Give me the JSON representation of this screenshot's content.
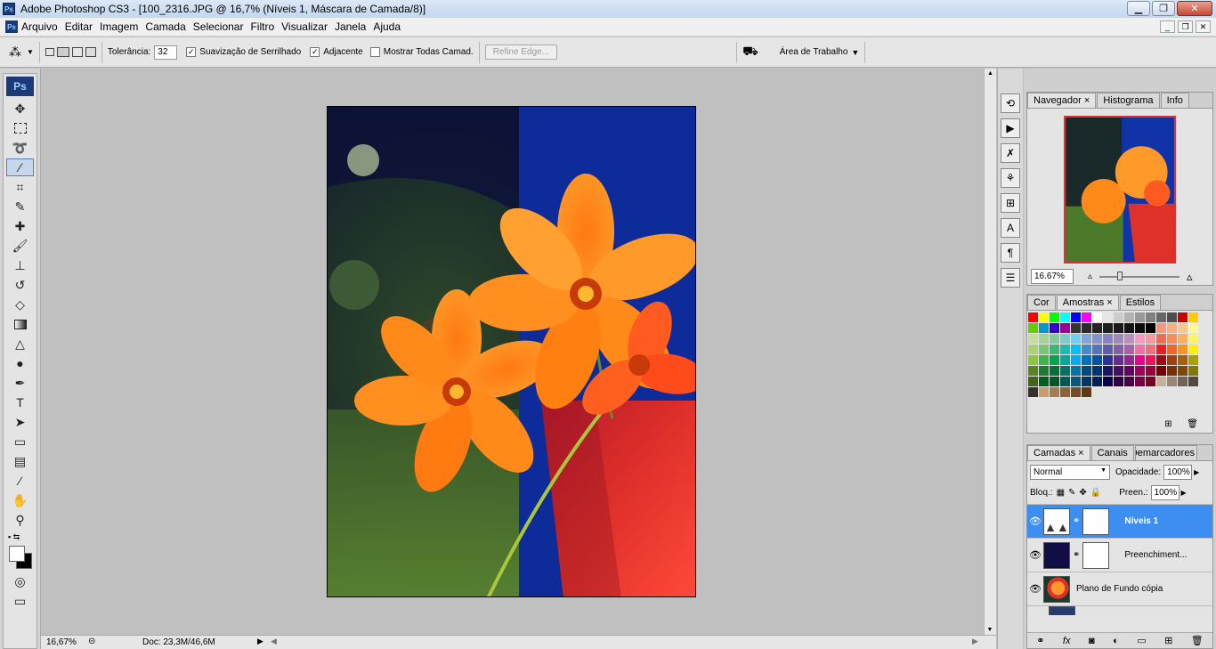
{
  "title": "Adobe Photoshop CS3 - [100_2316.JPG @ 16,7% (Níveis 1, Máscara de Camada/8)]",
  "app_icon": "Ps",
  "menu": [
    "Arquivo",
    "Editar",
    "Imagem",
    "Camada",
    "Selecionar",
    "Filtro",
    "Visualizar",
    "Janela",
    "Ajuda"
  ],
  "options": {
    "tolerance_label": "Tolerância:",
    "tolerance_value": "32",
    "antialias_label": "Suavização de Serrilhado",
    "contiguous_label": "Adjacente",
    "sample_all_label": "Mostrar Todas Camad.",
    "refine_edge": "Refine Edge...",
    "workspace": "Área de Trabalho"
  },
  "status": {
    "zoom": "16,67%",
    "doc": "Doc: 23,3M/46,6M"
  },
  "navigator": {
    "tabs": [
      "Navegador",
      "Histograma",
      "Info"
    ],
    "zoom": "16.67%"
  },
  "swatches": {
    "tabs": [
      "Cor",
      "Amostras",
      "Estilos"
    ],
    "colors": [
      "#ff0000",
      "#ffff00",
      "#00ff00",
      "#00ffff",
      "#0000ff",
      "#ff00ff",
      "#ffffff",
      "#e6e6e6",
      "#cccccc",
      "#b3b3b3",
      "#999999",
      "#808080",
      "#666666",
      "#4d4d4d",
      "#cc0000",
      "#ffcc00",
      "#66cc00",
      "#0099cc",
      "#3300cc",
      "#990099",
      "#333333",
      "#2b2b2b",
      "#242424",
      "#1f1f1f",
      "#1a1a1a",
      "#141414",
      "#0d0d0d",
      "#000000",
      "#f7977a",
      "#f9ad81",
      "#fdc68a",
      "#fff79a",
      "#c4df9b",
      "#a3d39c",
      "#82ca9d",
      "#7bcdc8",
      "#6ecff6",
      "#7ea7d8",
      "#8493ca",
      "#8882be",
      "#a187be",
      "#bc8dbf",
      "#f49ac2",
      "#f6989d",
      "#f26c4f",
      "#f68e55",
      "#fbaf5c",
      "#fff467",
      "#acd372",
      "#7cc576",
      "#3bb878",
      "#1abbb4",
      "#00bff3",
      "#438ccb",
      "#5574b9",
      "#605ca8",
      "#855fa8",
      "#a763a8",
      "#f06ea9",
      "#f26d7d",
      "#ed1c24",
      "#f26522",
      "#f7941d",
      "#fff200",
      "#8dc73f",
      "#39b54a",
      "#00a651",
      "#00a99d",
      "#00aeef",
      "#0072bc",
      "#0054a6",
      "#2e3192",
      "#662d91",
      "#92278f",
      "#ec008c",
      "#ed145b",
      "#9e0b0f",
      "#a0410d",
      "#a36209",
      "#aba000",
      "#598527",
      "#1a7b30",
      "#007236",
      "#00746b",
      "#0076a3",
      "#004b80",
      "#003471",
      "#1b1464",
      "#440e62",
      "#630460",
      "#9e005d",
      "#9e0039",
      "#790000",
      "#7b2e00",
      "#7d4900",
      "#827b00",
      "#406618",
      "#005e20",
      "#005826",
      "#005952",
      "#005b7f",
      "#003663",
      "#002157",
      "#0d004c",
      "#32004b",
      "#4b0049",
      "#7b0046",
      "#7a0026",
      "#c7b299",
      "#998675",
      "#736357",
      "#534741",
      "#37302d",
      "#c69c6d",
      "#a67c52",
      "#8c6239",
      "#754c24",
      "#603913"
    ]
  },
  "layers": {
    "tabs": [
      "Camadas",
      "Canais",
      "Demarcadores"
    ],
    "blend": "Normal",
    "opacity_label": "Opacidade:",
    "opacity": "100%",
    "lock_label": "Bloq.:",
    "fill_label": "Preen.:",
    "fill": "100%",
    "items": [
      {
        "name": "Níveis 1"
      },
      {
        "name": "Preenchiment..."
      },
      {
        "name": "Plano de Fundo cópia"
      }
    ]
  }
}
